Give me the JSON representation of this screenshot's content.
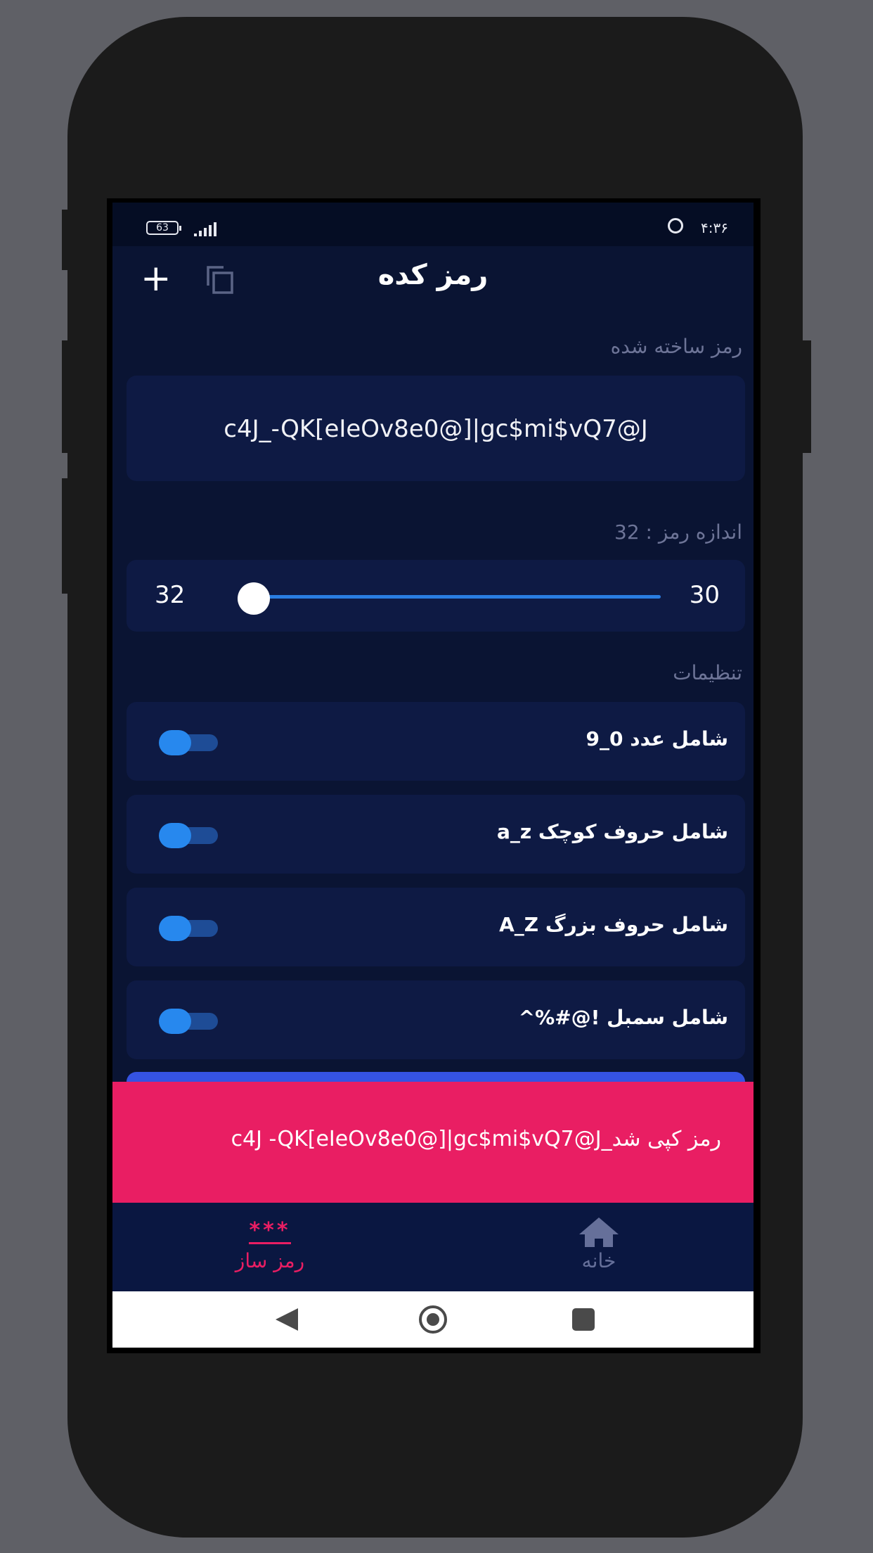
{
  "status_bar": {
    "battery": "63",
    "time": "۴:۳۶"
  },
  "app_bar": {
    "title": "رمز کده",
    "add_icon": "plus-icon",
    "copy_icon": "copy-icon"
  },
  "generated": {
    "label": "رمز ساخته شده",
    "password": "c4J_-QK[eIeOv8e0@]|gc$mi$vQ7@J"
  },
  "length": {
    "label": "اندازه رمز : 32",
    "min": "30",
    "max": "32",
    "value": 32
  },
  "settings": {
    "label": "تنظیمات",
    "options": [
      {
        "label": "شامل عدد  0_9",
        "enabled": true
      },
      {
        "label": "شامل حروف کوچک  a_z",
        "enabled": true
      },
      {
        "label": "شامل حروف بزرگ  A_Z",
        "enabled": true
      },
      {
        "label": "شامل سمبل  !@#%^",
        "enabled": true
      }
    ]
  },
  "snackbar": {
    "message": "رمز کپی شد_c4J -QK[eIeOv8e0@]|gc$mi$vQ7@J"
  },
  "bottom_nav": {
    "items": [
      {
        "label": "رمز ساز",
        "icon": "asterisks-icon",
        "active": true
      },
      {
        "label": "خانه",
        "icon": "home-icon",
        "active": false
      }
    ]
  },
  "colors": {
    "background": "#0a1433",
    "card": "#0e1a44",
    "accent": "#e91e63",
    "toggle": "#2788ee"
  }
}
